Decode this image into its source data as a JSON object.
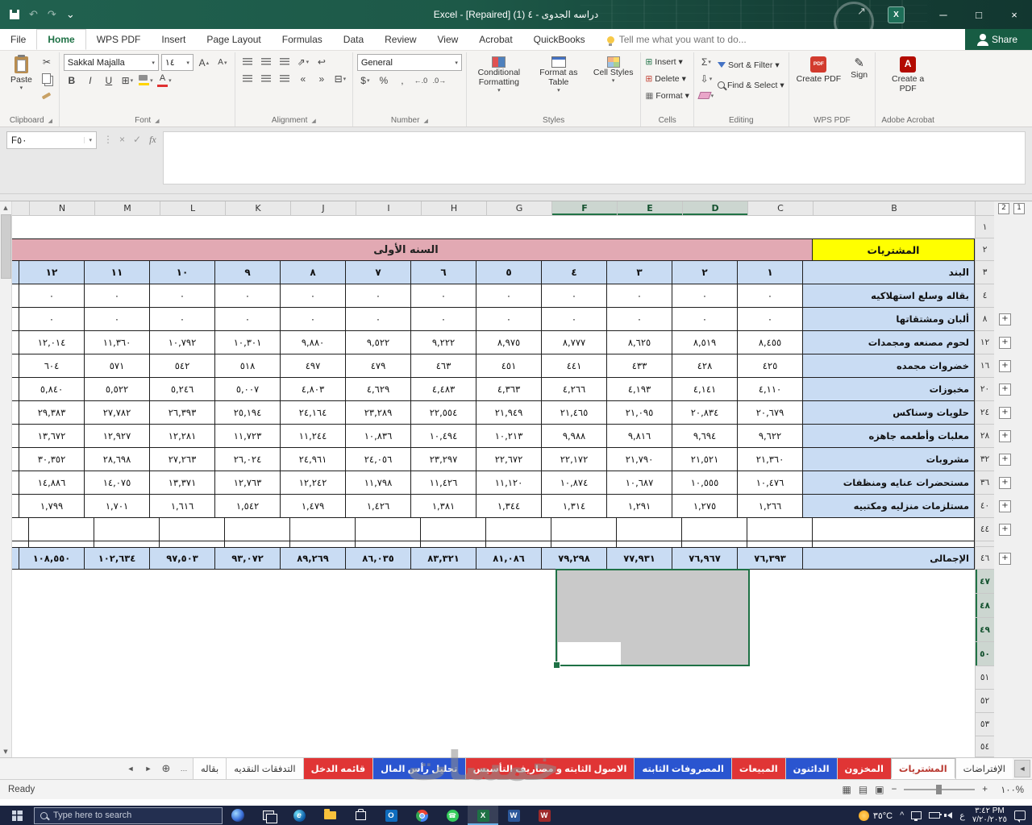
{
  "titlebar": {
    "title": "دراسه الجدوى - ٤ (1) [Repaired] - Excel"
  },
  "icons": {
    "undo": "↶",
    "redo": "↷",
    "customize": "⌄",
    "minimize": "─",
    "maximize": "□",
    "close": "×",
    "dropdown": "▾",
    "launcher": "◢",
    "dots": "⋮",
    "check": "✓",
    "cancel": "×",
    "fx": "fx",
    "scissors": "✂",
    "bold": "B",
    "italic": "I",
    "underline": "U",
    "font_a": "A",
    "up_small": "▴",
    "down_small": "▾",
    "borders": "⊞",
    "merge": "⊟",
    "wrap": "↩",
    "orientation": "⇗",
    "indent_left": "«",
    "indent_right": "»",
    "dollar": "$",
    "percent": "%",
    "comma": ",",
    "inc_decimal": "←.0",
    "dec_decimal": ".0→",
    "autosum": "Σ",
    "fill_down": "⇩",
    "sign": "✎",
    "pdf": "PDF",
    "acrobat_a": "A",
    "up": "▲",
    "down": "▼",
    "nav_left": "◄",
    "nav_right": "►",
    "ellipsis": "…",
    "new_sheet": "⊕",
    "plus": "+",
    "view_normal": "▦",
    "view_layout": "▤",
    "view_break": "▣",
    "minus": "−",
    "plus_zoom": "+",
    "edge": "e",
    "outlook": "O",
    "excel": "X",
    "word": "W",
    "wps": "W",
    "phone": "☎",
    "chevron_up": "^",
    "arrow_ne": "↗"
  },
  "ribbon_tabs": {
    "tabs": [
      {
        "label": "File"
      },
      {
        "label": "Home",
        "active": true
      },
      {
        "label": "WPS PDF"
      },
      {
        "label": "Insert"
      },
      {
        "label": "Page Layout"
      },
      {
        "label": "Formulas"
      },
      {
        "label": "Data"
      },
      {
        "label": "Review"
      },
      {
        "label": "View"
      },
      {
        "label": "Acrobat"
      },
      {
        "label": "QuickBooks"
      }
    ],
    "tell_me": "Tell me what you want to do...",
    "share": "Share"
  },
  "ribbon": {
    "clipboard": {
      "paste": "Paste",
      "label": "Clipboard"
    },
    "font": {
      "name": "Sakkal Majalla",
      "size": "١٤",
      "label": "Font"
    },
    "alignment": {
      "label": "Alignment"
    },
    "number": {
      "format": "General",
      "label": "Number"
    },
    "styles": {
      "conditional": "Conditional Formatting",
      "table": "Format as Table",
      "cell": "Cell Styles",
      "label": "Styles"
    },
    "cells": {
      "insert": "Insert",
      "delete": "Delete",
      "format": "Format",
      "label": "Cells"
    },
    "editing": {
      "sort": "Sort & Filter",
      "find": "Find & Select",
      "label": "Editing"
    },
    "wps": {
      "create": "Create PDF",
      "sign": "Sign",
      "label": "WPS PDF"
    },
    "acrobat": {
      "create": "Create a PDF",
      "label": "Adobe Acrobat"
    }
  },
  "formula_bar": {
    "name_box": "F٥٠"
  },
  "sheet": {
    "outline_levels": [
      "2",
      "1"
    ],
    "columns": {
      "letters": [
        "B",
        "C",
        "D",
        "E",
        "F",
        "G",
        "H",
        "I",
        "J",
        "K",
        "L",
        "M",
        "N"
      ],
      "selected": [
        "D",
        "E",
        "F"
      ]
    },
    "lead_nums": [
      "١",
      "٢",
      "٣"
    ],
    "title_cell": "المشتريات",
    "year_banner": "السنه الأولى",
    "item_header": "البند",
    "months": [
      "١",
      "٢",
      "٣",
      "٤",
      "٥",
      "٦",
      "٧",
      "٨",
      "٩",
      "١٠",
      "١١",
      "١٢"
    ],
    "rows": [
      {
        "num": "٤",
        "label": "بقاله وسلع استهلاكيه",
        "plus": false,
        "partial": "٠",
        "values": [
          "٠",
          "٠",
          "٠",
          "٠",
          "٠",
          "٠",
          "٠",
          "٠",
          "٠",
          "٠",
          "٠",
          "٠"
        ]
      },
      {
        "num": "٨",
        "label": "ألبان ومشتقاتها",
        "plus": true,
        "partial": "٠",
        "values": [
          "٠",
          "٠",
          "٠",
          "٠",
          "٠",
          "٠",
          "٠",
          "٠",
          "٠",
          "٠",
          "٠",
          "٠"
        ]
      },
      {
        "num": "١٢",
        "label": "لحوم مصنعه ومجمدات",
        "plus": true,
        "partial": "",
        "values": [
          "٨,٤٥٥",
          "٨,٥١٩",
          "٨,٦٢٥",
          "٨,٧٧٧",
          "٨,٩٧٥",
          "٩,٢٢٢",
          "٩,٥٢٢",
          "٩,٨٨٠",
          "١٠,٣٠١",
          "١٠,٧٩٢",
          "١١,٣٦٠",
          "١٢,٠١٤"
        ]
      },
      {
        "num": "١٦",
        "label": "خضروات مجمده",
        "plus": true,
        "partial": "",
        "values": [
          "٤٢٥",
          "٤٢٨",
          "٤٣٣",
          "٤٤١",
          "٤٥١",
          "٤٦٣",
          "٤٧٩",
          "٤٩٧",
          "٥١٨",
          "٥٤٢",
          "٥٧١",
          "٦٠٤"
        ]
      },
      {
        "num": "٢٠",
        "label": "مخبوزات",
        "plus": true,
        "partial": "",
        "values": [
          "٤,١١٠",
          "٤,١٤١",
          "٤,١٩٣",
          "٤,٢٦٦",
          "٤,٣٦٣",
          "٤,٤٨٣",
          "٤,٦٢٩",
          "٤,٨٠٣",
          "٥,٠٠٧",
          "٥,٢٤٦",
          "٥,٥٢٢",
          "٥,٨٤٠"
        ]
      },
      {
        "num": "٢٤",
        "label": "حلويات وسناكس",
        "plus": true,
        "partial": "",
        "values": [
          "٢٠,٦٧٩",
          "٢٠,٨٣٤",
          "٢١,٠٩٥",
          "٢١,٤٦٥",
          "٢١,٩٤٩",
          "٢٢,٥٥٤",
          "٢٣,٢٨٩",
          "٢٤,١٦٤",
          "٢٥,١٩٤",
          "٢٦,٣٩٣",
          "٢٧,٧٨٢",
          "٢٩,٣٨٣"
        ]
      },
      {
        "num": "٢٨",
        "label": "معلبات وأطعمه جاهزه",
        "plus": true,
        "partial": "",
        "values": [
          "٩,٦٢٢",
          "٩,٦٩٤",
          "٩,٨١٦",
          "٩,٩٨٨",
          "١٠,٢١٣",
          "١٠,٤٩٤",
          "١٠,٨٣٦",
          "١١,٢٤٤",
          "١١,٧٢٣",
          "١٢,٢٨١",
          "١٢,٩٢٧",
          "١٣,٦٧٢"
        ]
      },
      {
        "num": "٣٢",
        "label": "مشروبات",
        "plus": true,
        "partial": "",
        "values": [
          "٢١,٣٦٠",
          "٢١,٥٢١",
          "٢١,٧٩٠",
          "٢٢,١٧٢",
          "٢٢,٦٧٢",
          "٢٣,٢٩٧",
          "٢٤,٠٥٦",
          "٢٤,٩٦١",
          "٢٦,٠٢٤",
          "٢٧,٢٦٣",
          "٢٨,٦٩٨",
          "٣٠,٣٥٢"
        ]
      },
      {
        "num": "٣٦",
        "label": "مستحضرات عنايه ومنظفات",
        "plus": true,
        "partial": "",
        "values": [
          "١٠,٤٧٦",
          "١٠,٥٥٥",
          "١٠,٦٨٧",
          "١٠,٨٧٤",
          "١١,١٢٠",
          "١١,٤٢٦",
          "١١,٧٩٨",
          "١٢,٢٤٢",
          "١٢,٧٦٣",
          "١٣,٣٧١",
          "١٤,٠٧٥",
          "١٤,٨٨٦"
        ]
      },
      {
        "num": "٤٠",
        "label": "مستلزمات منزليه ومكتبيه",
        "plus": true,
        "partial": "",
        "values": [
          "١,٢٦٦",
          "١,٢٧٥",
          "١,٢٩١",
          "١,٣١٤",
          "١,٣٤٤",
          "١,٣٨١",
          "١,٤٢٦",
          "١,٤٧٩",
          "١,٥٤٢",
          "١,٦١٦",
          "١,٧٠١",
          "١,٧٩٩"
        ]
      }
    ],
    "empty_row_num": "٤٤",
    "total": {
      "num": "٤٦",
      "label": "الإجمالى",
      "partial": "١",
      "values": [
        "٧٦,٣٩٣",
        "٧٦,٩٦٧",
        "٧٧,٩٣١",
        "٧٩,٢٩٨",
        "٨١,٠٨٦",
        "٨٣,٣٢١",
        "٨٦,٠٣٥",
        "٨٩,٢٦٩",
        "٩٣,٠٧٢",
        "٩٧,٥٠٣",
        "١٠٢,٦٣٤",
        "١٠٨,٥٥٠"
      ]
    },
    "trailing": [
      {
        "num": "٤٧",
        "sel": true
      },
      {
        "num": "٤٨",
        "sel": true
      },
      {
        "num": "٤٩",
        "sel": true
      },
      {
        "num": "٥٠",
        "sel": true
      },
      {
        "num": "٥١"
      },
      {
        "num": "٥٢"
      },
      {
        "num": "٥٣"
      },
      {
        "num": "٥٤"
      }
    ]
  },
  "sheet_tabs": {
    "tabs": [
      {
        "label": "الإفتراضات",
        "color": "white"
      },
      {
        "label": "المشتريات",
        "color": "white",
        "active": true
      },
      {
        "label": "المخزون",
        "color": "red"
      },
      {
        "label": "الدائنون",
        "color": "blue"
      },
      {
        "label": "المبيعات",
        "color": "red"
      },
      {
        "label": "المصروفات الثابته",
        "color": "blue"
      },
      {
        "label": "الاصول الثابته و مصاريف التأسيس",
        "color": "red"
      },
      {
        "label": "تحليل رأس المال",
        "color": "blue"
      },
      {
        "label": "قائمه الدخل",
        "color": "red"
      },
      {
        "label": "التدفقات النقديه",
        "color": "white"
      },
      {
        "label": "بقاله",
        "color": "white"
      }
    ]
  },
  "status": {
    "ready": "Ready",
    "zoom": "١٠٠%"
  },
  "watermark": "خمسات",
  "taskbar": {
    "search": "Type here to search",
    "weather": "٣٥°C",
    "lang": "ع",
    "time": "٣:٤٢ PM",
    "date": "٧/٢٠/٢٠٢٥"
  }
}
